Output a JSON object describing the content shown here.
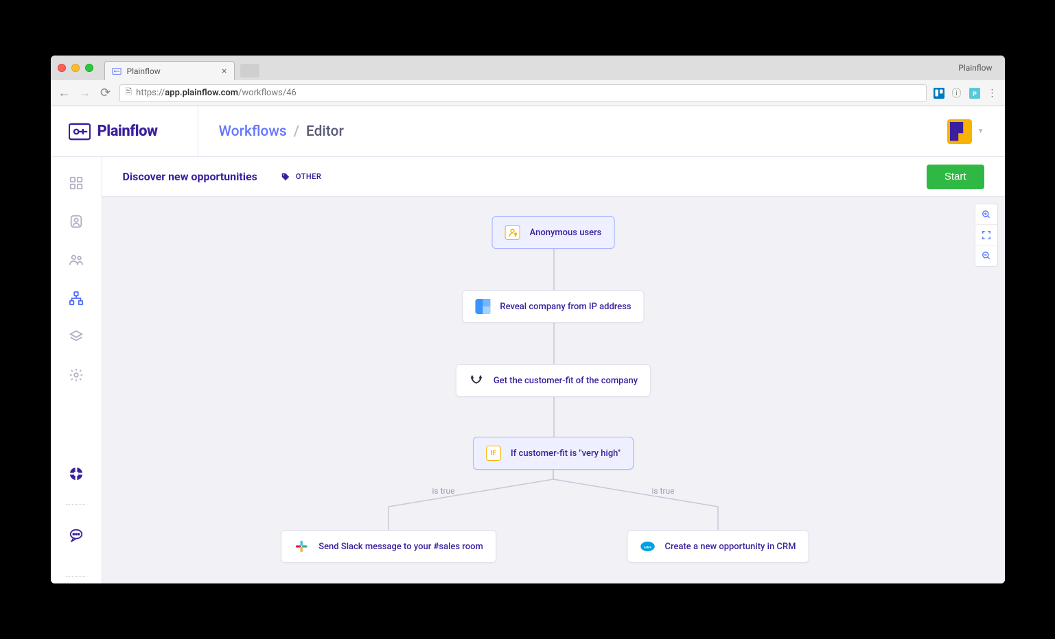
{
  "browser": {
    "tab_title": "Plainflow",
    "profile": "Plainflow",
    "url_host": "app.plainflow.com",
    "url_path": "/workflows/46",
    "url_prefix": "https://"
  },
  "brand": "Plainflow",
  "breadcrumbs": {
    "section": "Workflows",
    "sep": "/",
    "current": "Editor"
  },
  "workflow": {
    "title": "Discover new opportunities",
    "tag": "OTHER",
    "start_button": "Start"
  },
  "nodes": {
    "trigger": "Anonymous users",
    "step1": "Reveal company from IP address",
    "step2": "Get the customer-fit of the company",
    "condition": "If customer-fit is \"very high\"",
    "branch_left": "is true",
    "branch_right": "is true",
    "action_left": "Send Slack message to your #sales room",
    "action_right": "Create a new opportunity in CRM"
  }
}
